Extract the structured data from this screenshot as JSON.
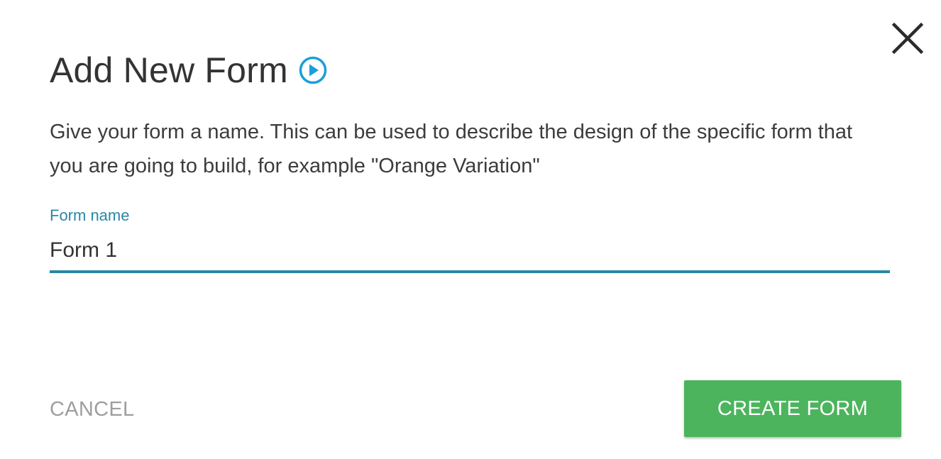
{
  "dialog": {
    "title": "Add New Form",
    "description": "Give your form a name. This can be used to describe the design of the specific form that you are going to build, for example \"Orange Variation\"",
    "play_icon": "play-circle-icon",
    "close_icon": "close-icon"
  },
  "form_name_field": {
    "label": "Form name",
    "value": "Form 1",
    "placeholder": ""
  },
  "actions": {
    "cancel_label": "CANCEL",
    "create_label": "CREATE FORM"
  },
  "colors": {
    "accent": "#2a87a5",
    "play_icon": "#1a9fd9",
    "create_button": "#4cb45d",
    "cancel_text": "#9e9e9e",
    "title_text": "#333333"
  }
}
